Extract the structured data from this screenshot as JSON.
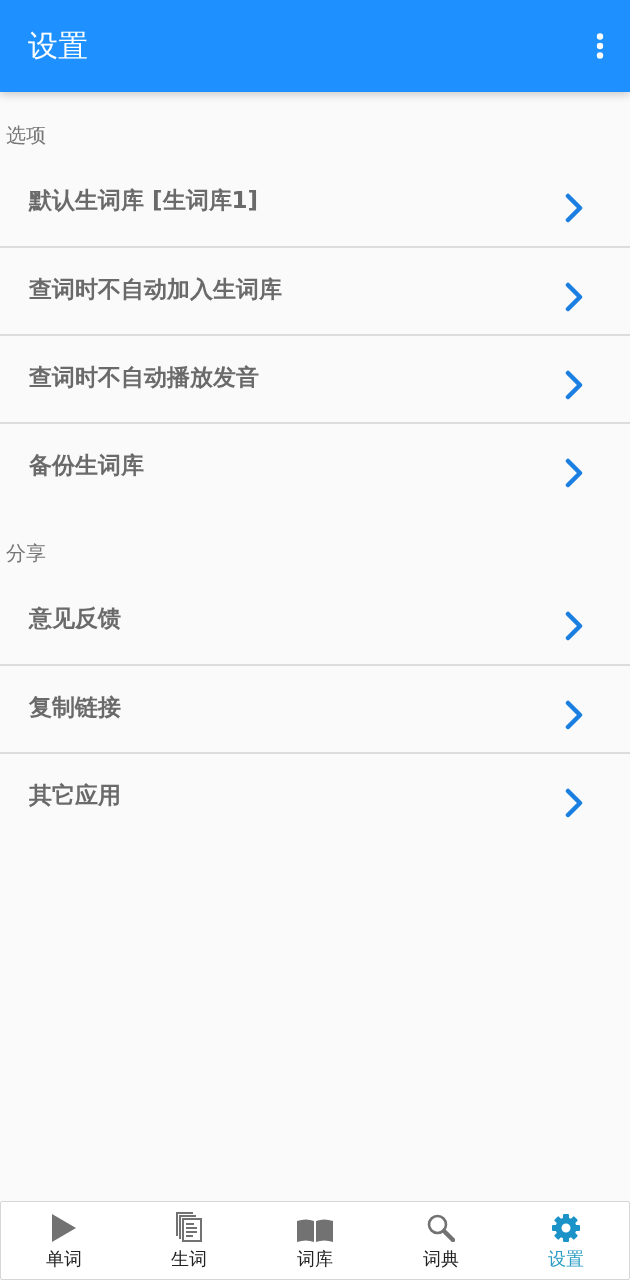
{
  "app_bar": {
    "title": "设置"
  },
  "sections": [
    {
      "title": "选项",
      "items": [
        {
          "label": "默认生词库 [生词库1]"
        },
        {
          "label": "查词时不自动加入生词库"
        },
        {
          "label": "查词时不自动播放发音"
        },
        {
          "label": "备份生词库"
        }
      ]
    },
    {
      "title": "分享",
      "items": [
        {
          "label": "意见反馈"
        },
        {
          "label": "复制链接"
        },
        {
          "label": "其它应用"
        }
      ]
    }
  ],
  "bottom_nav": [
    {
      "label": "单词",
      "kind": "play",
      "selected": false
    },
    {
      "label": "生词",
      "kind": "pages",
      "selected": false
    },
    {
      "label": "词库",
      "kind": "book",
      "selected": false
    },
    {
      "label": "词典",
      "kind": "search",
      "selected": false
    },
    {
      "label": "设置",
      "kind": "gear",
      "selected": true
    }
  ]
}
